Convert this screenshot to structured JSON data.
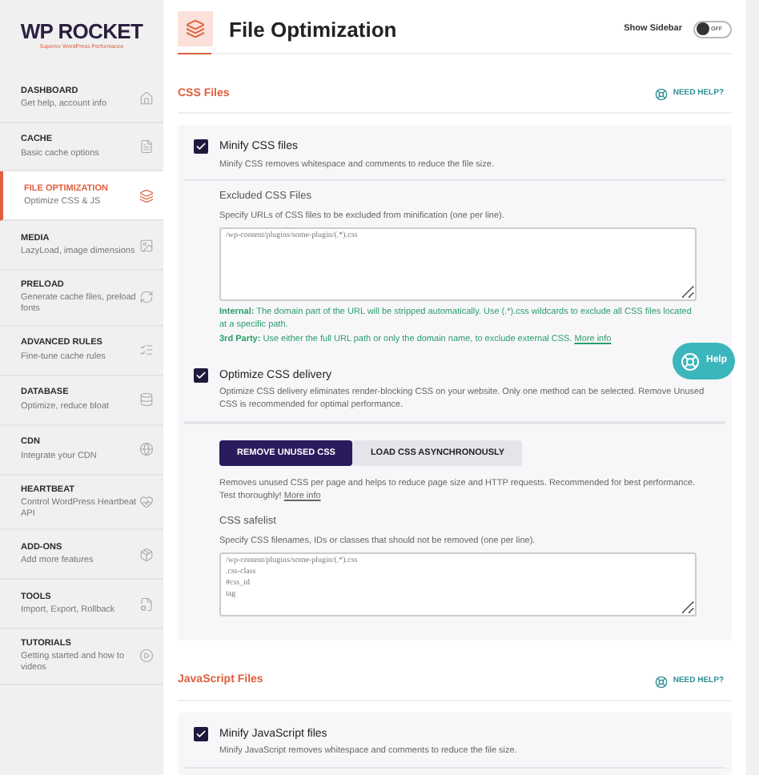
{
  "sidebar": {
    "logo": {
      "title": "WP ROCKET",
      "tagline": "Superior WordPress Performance"
    },
    "items": [
      {
        "title": "DASHBOARD",
        "description": "Get help, account info",
        "selected": false
      },
      {
        "title": "CACHE",
        "description": "Basic cache options",
        "selected": false
      },
      {
        "title": "FILE OPTIMIZATION",
        "description": "Optimize CSS & JS",
        "selected": true
      },
      {
        "title": "MEDIA",
        "description": "LazyLoad, image dimensions",
        "selected": false
      },
      {
        "title": "PRELOAD",
        "description": "Generate cache files, preload fonts",
        "selected": false
      },
      {
        "title": "ADVANCED RULES",
        "description": "Fine-tune cache rules",
        "selected": false
      },
      {
        "title": "DATABASE",
        "description": "Optimize, reduce bloat",
        "selected": false
      },
      {
        "title": "CDN",
        "description": "Integrate your CDN",
        "selected": false
      },
      {
        "title": "HEARTBEAT",
        "description": "Control WordPress Heartbeat API",
        "selected": false
      },
      {
        "title": "ADD-ONS",
        "description": "Add more features",
        "selected": false
      },
      {
        "title": "TOOLS",
        "description": "Import, Export, Rollback",
        "selected": false
      },
      {
        "title": "TUTORIALS",
        "description": "Getting started and how to videos",
        "selected": false
      }
    ]
  },
  "header": {
    "title": "File Optimization",
    "toggle_label": "Show Sidebar",
    "toggle": {
      "on": false,
      "text": "OFF"
    }
  },
  "sections": [
    {
      "title": "CSS Files",
      "help": "NEED HELP?",
      "blocks": [
        {
          "kind": "checkbox",
          "label": "Minify CSS files",
          "description": "Minify CSS removes whitespace and comments to reduce the file size.",
          "checked": true
        },
        {
          "kind": "field",
          "label": "Excluded CSS Files",
          "description": "Specify URLs of CSS files to be excluded from minification (one per line).",
          "placeholder": "/wp-content/plugins/some-plugin/(.*).css",
          "notes": [
            {
              "text": "**Internal:** The domain part of the URL will be stripped automatically. Use (.*).css wildcards to exclude all CSS files located at a specific path."
            },
            {
              "text": "**3rd Party:** Use either the full URL path or only the domain name, to exclude external CSS.",
              "link": "More info"
            }
          ]
        },
        {
          "kind": "checkbox",
          "label": "Optimize CSS delivery",
          "description": "Optimize CSS delivery eliminates render-blocking CSS on your website. Only one method can be selected. Remove Unused CSS is recommended for optimal performance.",
          "checked": true
        },
        {
          "kind": "choice",
          "options": [
            {
              "label": "REMOVE UNUSED CSS",
              "selected": true
            },
            {
              "label": "LOAD CSS ASYNCHRONOUSLY",
              "selected": false
            }
          ],
          "description": "Removes unused CSS per page and helps to reduce page size and HTTP requests. Recommended for best performance. Test thoroughly!",
          "link": "More info"
        },
        {
          "kind": "field",
          "label": "CSS safelist",
          "description": "Specify CSS filenames, IDs or classes that should not be removed (one per line).",
          "placeholder": "/wp-content/plugins/some-plugin/(.*).css\n.css-class\n#css_id\ntag"
        }
      ]
    },
    {
      "title": "JavaScript Files",
      "help": "NEED HELP?",
      "blocks": [
        {
          "kind": "checkbox",
          "label": "Minify JavaScript files",
          "description": "Minify JavaScript removes whitespace and comments to reduce the file size.",
          "checked": true
        }
      ]
    }
  ],
  "help_button": "Help"
}
